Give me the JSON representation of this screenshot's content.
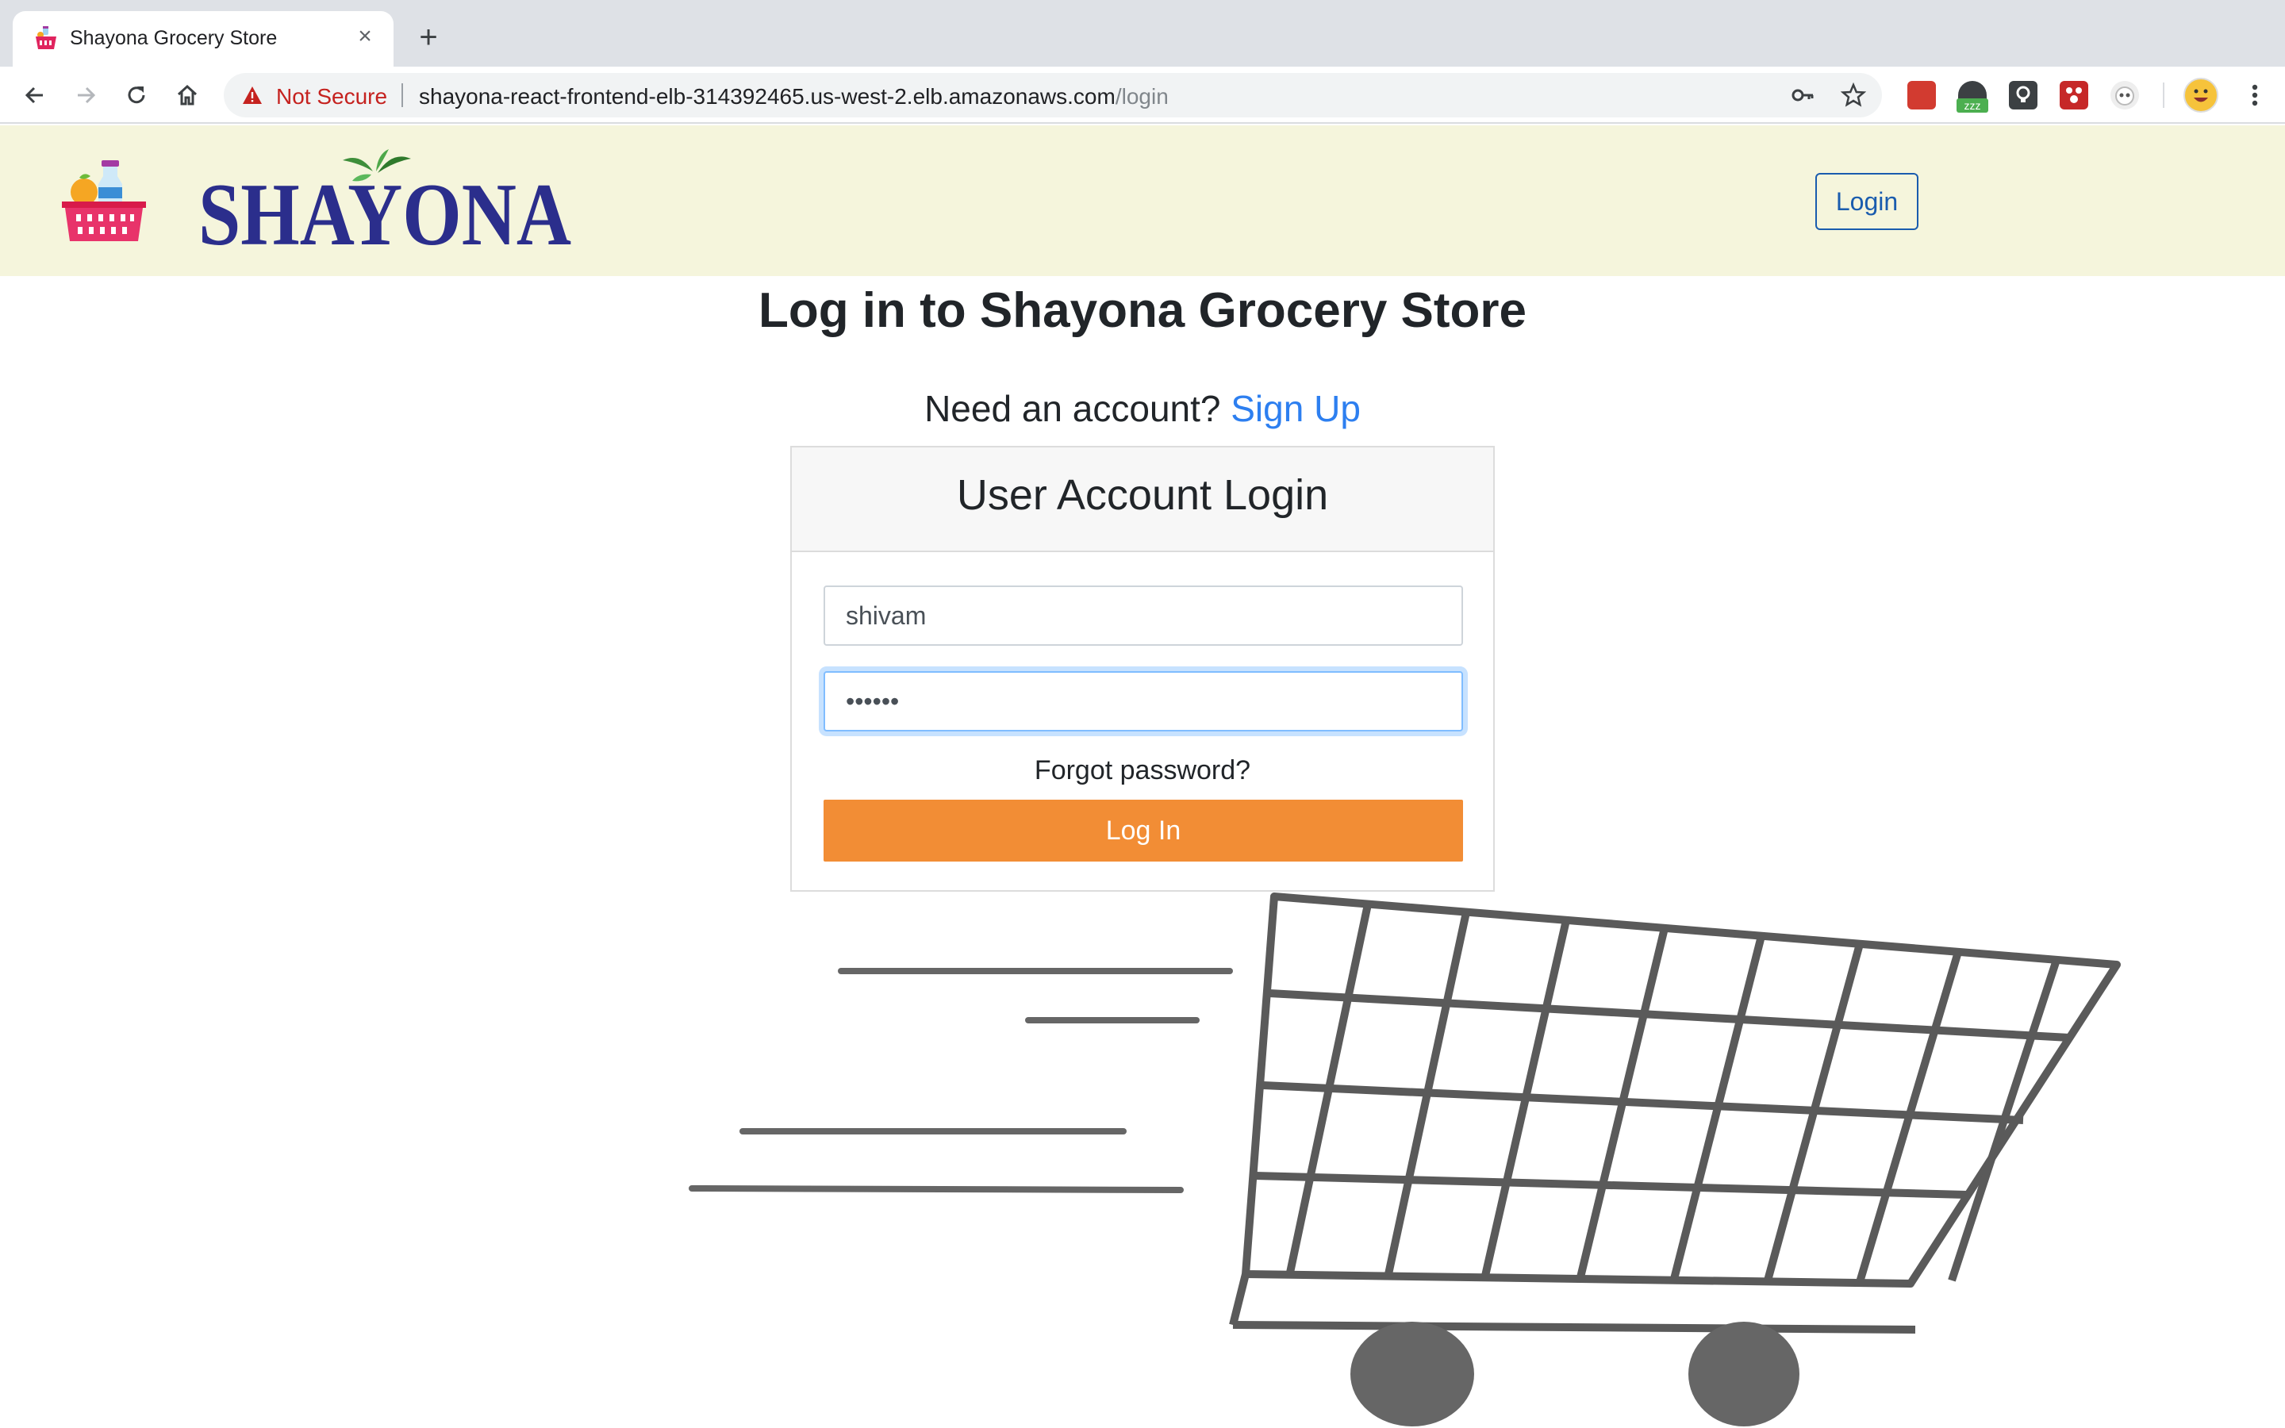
{
  "browser": {
    "tab_title": "Shayona Grocery Store",
    "new_tab_symbol": "+",
    "close_symbol": "×",
    "security_label": "Not Secure",
    "url_host": "shayona-react-frontend-elb-314392465.us-west-2.elb.amazonaws.com",
    "url_path": "/login",
    "extensions": [
      "red-book-extension",
      "sleep-extension",
      "lightbulb-extension",
      "red-dots-extension",
      "panda-extension"
    ],
    "extension_badge": "zzz"
  },
  "header": {
    "brand": "SHAYONA",
    "login_label": "Login"
  },
  "page": {
    "title": "Log in to Shayona Grocery Store",
    "need_account": "Need an account?",
    "signup_label": "Sign Up"
  },
  "login_card": {
    "heading": "User Account Login",
    "username_value": "shivam",
    "password_value": "••••••",
    "forgot_label": "Forgot password?",
    "submit_label": "Log In"
  },
  "colors": {
    "header_bg": "#f5f5dc",
    "brand_blue": "#2b2e8c",
    "link_blue": "#2d7ff0",
    "button_orange": "#f28d35",
    "focus_blue": "#80bdff"
  }
}
